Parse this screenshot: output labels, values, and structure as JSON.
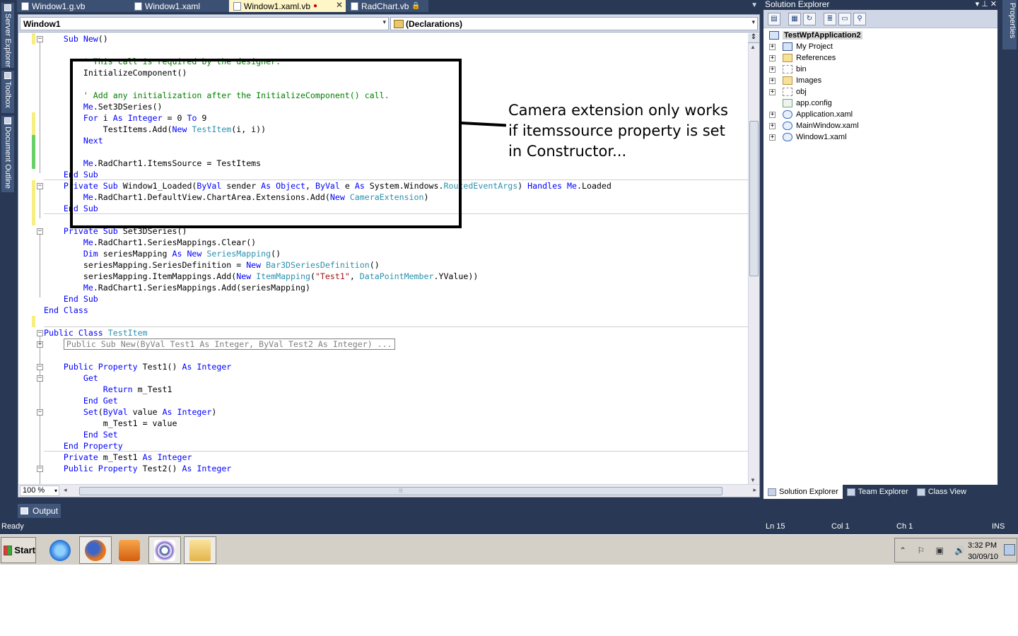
{
  "tabs": [
    {
      "label": "Window1.g.vb",
      "active": false,
      "modified": false,
      "locked": false,
      "closable": false
    },
    {
      "label": "Window1.xaml",
      "active": false,
      "modified": false,
      "locked": false,
      "closable": false
    },
    {
      "label": "Window1.xaml.vb",
      "active": true,
      "modified": true,
      "locked": false,
      "closable": true
    },
    {
      "label": "RadChart.vb",
      "active": false,
      "modified": false,
      "locked": true,
      "closable": false
    }
  ],
  "tab_markers": {
    "modified": "●",
    "close": "✕",
    "lock": "🔒",
    "dropdown": "▼"
  },
  "nav": {
    "class_combo": "Window1",
    "member_combo": "(Declarations)",
    "arrow": "▾"
  },
  "left_tools": [
    {
      "label": "Server Explorer"
    },
    {
      "label": "Toolbox"
    },
    {
      "label": "Document Outline"
    }
  ],
  "code_lines": [
    {
      "segments": [
        [
          "    ",
          ""
        ],
        [
          "Sub ",
          "kw"
        ],
        [
          "New",
          "kw"
        ],
        [
          "()",
          ""
        ]
      ]
    },
    {
      "segments": [
        [
          "",
          ""
        ]
      ]
    },
    {
      "segments": [
        [
          "        ",
          ""
        ],
        [
          "' This call is required by the designer.",
          "cm"
        ]
      ]
    },
    {
      "segments": [
        [
          "        InitializeComponent()",
          ""
        ]
      ]
    },
    {
      "segments": [
        [
          "",
          ""
        ]
      ]
    },
    {
      "segments": [
        [
          "        ",
          ""
        ],
        [
          "' Add any initialization after the InitializeComponent() call.",
          "cm"
        ]
      ]
    },
    {
      "segments": [
        [
          "        ",
          ""
        ],
        [
          "Me",
          "kw"
        ],
        [
          ".Set3DSeries()",
          ""
        ]
      ]
    },
    {
      "segments": [
        [
          "        ",
          ""
        ],
        [
          "For",
          "kw"
        ],
        [
          " i ",
          ""
        ],
        [
          "As",
          "kw"
        ],
        [
          " ",
          ""
        ],
        [
          "Integer",
          "kw"
        ],
        [
          " = 0 ",
          ""
        ],
        [
          "To",
          "kw"
        ],
        [
          " 9",
          ""
        ]
      ]
    },
    {
      "segments": [
        [
          "            TestItems.Add(",
          ""
        ],
        [
          "New",
          "kw"
        ],
        [
          " ",
          ""
        ],
        [
          "TestItem",
          "ty"
        ],
        [
          "(i, i))",
          ""
        ]
      ]
    },
    {
      "segments": [
        [
          "        ",
          ""
        ],
        [
          "Next",
          "kw"
        ]
      ]
    },
    {
      "segments": [
        [
          "",
          ""
        ]
      ]
    },
    {
      "segments": [
        [
          "        ",
          ""
        ],
        [
          "Me",
          "kw"
        ],
        [
          ".RadChart1.ItemsSource = TestItems",
          ""
        ]
      ]
    },
    {
      "segments": [
        [
          "    ",
          ""
        ],
        [
          "End Sub",
          "kw"
        ]
      ]
    },
    {
      "segments": [
        [
          "    ",
          ""
        ],
        [
          "Private",
          "kw"
        ],
        [
          " ",
          ""
        ],
        [
          "Sub",
          "kw"
        ],
        [
          " Window1_Loaded(",
          ""
        ],
        [
          "ByVal",
          "kw"
        ],
        [
          " sender ",
          ""
        ],
        [
          "As",
          "kw"
        ],
        [
          " ",
          ""
        ],
        [
          "Object",
          "kw"
        ],
        [
          ", ",
          ""
        ],
        [
          "ByVal",
          "kw"
        ],
        [
          " e ",
          ""
        ],
        [
          "As",
          "kw"
        ],
        [
          " System.Windows.",
          ""
        ],
        [
          "RoutedEventArgs",
          "ty"
        ],
        [
          ") ",
          ""
        ],
        [
          "Handles",
          "kw"
        ],
        [
          " ",
          ""
        ],
        [
          "Me",
          "kw"
        ],
        [
          ".Loaded",
          ""
        ]
      ]
    },
    {
      "segments": [
        [
          "        ",
          ""
        ],
        [
          "Me",
          "kw"
        ],
        [
          ".RadChart1.DefaultView.ChartArea.Extensions.Add(",
          ""
        ],
        [
          "New",
          "kw"
        ],
        [
          " ",
          ""
        ],
        [
          "CameraExtension",
          "ty"
        ],
        [
          ")",
          ""
        ]
      ]
    },
    {
      "segments": [
        [
          "    ",
          ""
        ],
        [
          "End Sub",
          "kw"
        ]
      ]
    },
    {
      "segments": [
        [
          "",
          ""
        ]
      ]
    },
    {
      "segments": [
        [
          "    ",
          ""
        ],
        [
          "Private",
          "kw"
        ],
        [
          " ",
          ""
        ],
        [
          "Sub",
          "kw"
        ],
        [
          " Set3DSeries()",
          ""
        ]
      ]
    },
    {
      "segments": [
        [
          "        ",
          ""
        ],
        [
          "Me",
          "kw"
        ],
        [
          ".RadChart1.SeriesMappings.Clear()",
          ""
        ]
      ]
    },
    {
      "segments": [
        [
          "        ",
          ""
        ],
        [
          "Dim",
          "kw"
        ],
        [
          " seriesMapping ",
          ""
        ],
        [
          "As",
          "kw"
        ],
        [
          " ",
          ""
        ],
        [
          "New",
          "kw"
        ],
        [
          " ",
          ""
        ],
        [
          "SeriesMapping",
          "ty"
        ],
        [
          "()",
          ""
        ]
      ]
    },
    {
      "segments": [
        [
          "        seriesMapping.SeriesDefinition = ",
          ""
        ],
        [
          "New",
          "kw"
        ],
        [
          " ",
          ""
        ],
        [
          "Bar3DSeriesDefinition",
          "ty"
        ],
        [
          "()",
          ""
        ]
      ]
    },
    {
      "segments": [
        [
          "        seriesMapping.ItemMappings.Add(",
          ""
        ],
        [
          "New",
          "kw"
        ],
        [
          " ",
          ""
        ],
        [
          "ItemMapping",
          "ty"
        ],
        [
          "(",
          ""
        ],
        [
          "\"Test1\"",
          "st"
        ],
        [
          ", ",
          ""
        ],
        [
          "DataPointMember",
          "ty"
        ],
        [
          ".YValue))",
          ""
        ]
      ]
    },
    {
      "segments": [
        [
          "        ",
          ""
        ],
        [
          "Me",
          "kw"
        ],
        [
          ".RadChart1.SeriesMappings.Add(seriesMapping)",
          ""
        ]
      ]
    },
    {
      "segments": [
        [
          "    ",
          ""
        ],
        [
          "End Sub",
          "kw"
        ]
      ]
    },
    {
      "segments": [
        [
          "",
          ""
        ],
        [
          "End Class",
          "kw"
        ]
      ]
    },
    {
      "segments": [
        [
          "",
          ""
        ]
      ]
    },
    {
      "segments": [
        [
          "",
          ""
        ],
        [
          "Public",
          "kw"
        ],
        [
          " ",
          ""
        ],
        [
          "Class",
          "kw"
        ],
        [
          " ",
          ""
        ],
        [
          "TestItem",
          "ty"
        ]
      ]
    },
    {
      "segments": [
        [
          "    ",
          ""
        ],
        [
          "Public Sub New(ByVal Test1 As Integer, ByVal Test2 As Integer) ...",
          "collapsed"
        ]
      ]
    },
    {
      "segments": [
        [
          "",
          ""
        ]
      ]
    },
    {
      "segments": [
        [
          "    ",
          ""
        ],
        [
          "Public",
          "kw"
        ],
        [
          " ",
          ""
        ],
        [
          "Property",
          "kw"
        ],
        [
          " Test1() ",
          ""
        ],
        [
          "As",
          "kw"
        ],
        [
          " ",
          ""
        ],
        [
          "Integer",
          "kw"
        ]
      ]
    },
    {
      "segments": [
        [
          "        ",
          ""
        ],
        [
          "Get",
          "kw"
        ]
      ]
    },
    {
      "segments": [
        [
          "            ",
          ""
        ],
        [
          "Return",
          "kw"
        ],
        [
          " m_Test1",
          ""
        ]
      ]
    },
    {
      "segments": [
        [
          "        ",
          ""
        ],
        [
          "End Get",
          "kw"
        ]
      ]
    },
    {
      "segments": [
        [
          "        ",
          ""
        ],
        [
          "Set",
          "kw"
        ],
        [
          "(",
          ""
        ],
        [
          "ByVal",
          "kw"
        ],
        [
          " value ",
          ""
        ],
        [
          "As",
          "kw"
        ],
        [
          " ",
          ""
        ],
        [
          "Integer",
          "kw"
        ],
        [
          ")",
          ""
        ]
      ]
    },
    {
      "segments": [
        [
          "            m_Test1 = value",
          ""
        ]
      ]
    },
    {
      "segments": [
        [
          "        ",
          ""
        ],
        [
          "End Set",
          "kw"
        ]
      ]
    },
    {
      "segments": [
        [
          "    ",
          ""
        ],
        [
          "End Property",
          "kw"
        ]
      ]
    },
    {
      "segments": [
        [
          "    ",
          ""
        ],
        [
          "Private",
          "kw"
        ],
        [
          " m_Test1 ",
          ""
        ],
        [
          "As",
          "kw"
        ],
        [
          " ",
          ""
        ],
        [
          "Integer",
          "kw"
        ]
      ]
    },
    {
      "segments": [
        [
          "    ",
          ""
        ],
        [
          "Public",
          "kw"
        ],
        [
          " ",
          ""
        ],
        [
          "Property",
          "kw"
        ],
        [
          " Test2() ",
          ""
        ],
        [
          "As",
          "kw"
        ],
        [
          " ",
          ""
        ],
        [
          "Integer",
          "kw"
        ]
      ]
    }
  ],
  "annotation": {
    "text": "Camera extension only works if itemssource property is set in Constructor..."
  },
  "editor_footer": {
    "zoom": "100 %",
    "zoom_arrow": "▾",
    "grip": "⦙⦙⦙",
    "left": "◂",
    "right": "▸"
  },
  "scroll_glyphs": {
    "up": "▲",
    "down": "▼",
    "split": "⇕"
  },
  "solution_explorer": {
    "title": "Solution Explorer",
    "title_buttons": "▾ ⊥ ✕",
    "toolbar_icons": [
      "properties-icon",
      "show-all-files-icon",
      "refresh-icon",
      "view-code-icon",
      "view-designer-icon",
      "class-diagram-icon"
    ],
    "toolbar_glyphs": [
      "▤",
      "▦",
      "↻",
      "≣",
      "▭",
      "⚲"
    ],
    "root": "TestWpfApplication2",
    "items": [
      {
        "label": "My Project",
        "expander": "+",
        "icon": "proj"
      },
      {
        "label": "References",
        "expander": "+",
        "icon": "folder"
      },
      {
        "label": "bin",
        "expander": "+",
        "icon": "folder-dash"
      },
      {
        "label": "Images",
        "expander": "+",
        "icon": "folder"
      },
      {
        "label": "obj",
        "expander": "+",
        "icon": "folder-dash"
      },
      {
        "label": "app.config",
        "expander": "",
        "icon": "cfg"
      },
      {
        "label": "Application.xaml",
        "expander": "+",
        "icon": "xaml"
      },
      {
        "label": "MainWindow.xaml",
        "expander": "+",
        "icon": "xaml"
      },
      {
        "label": "Window1.xaml",
        "expander": "+",
        "icon": "xaml"
      }
    ],
    "bottom_tabs": [
      "Solution Explorer",
      "Team Explorer",
      "Class View"
    ]
  },
  "properties_label": "Properties",
  "output_label": "Output",
  "status": {
    "text": "Ready",
    "ln": "Ln 15",
    "col": "Col 1",
    "ch": "Ch 1",
    "mode": "INS"
  },
  "taskbar": {
    "start": "Start",
    "apps": [
      "internet-explorer",
      "firefox",
      "media-player",
      "visual-studio",
      "windows-explorer"
    ],
    "tray_icons": "⌃ ⚐ ▣ 🔊",
    "time": "3:32 PM",
    "date": "30/09/10"
  },
  "colors": {
    "ide_bg": "#293955",
    "active_tab": "#fff6c8",
    "keyword": "#0000ff",
    "type": "#2b91af",
    "comment": "#008000",
    "string": "#a31515"
  }
}
